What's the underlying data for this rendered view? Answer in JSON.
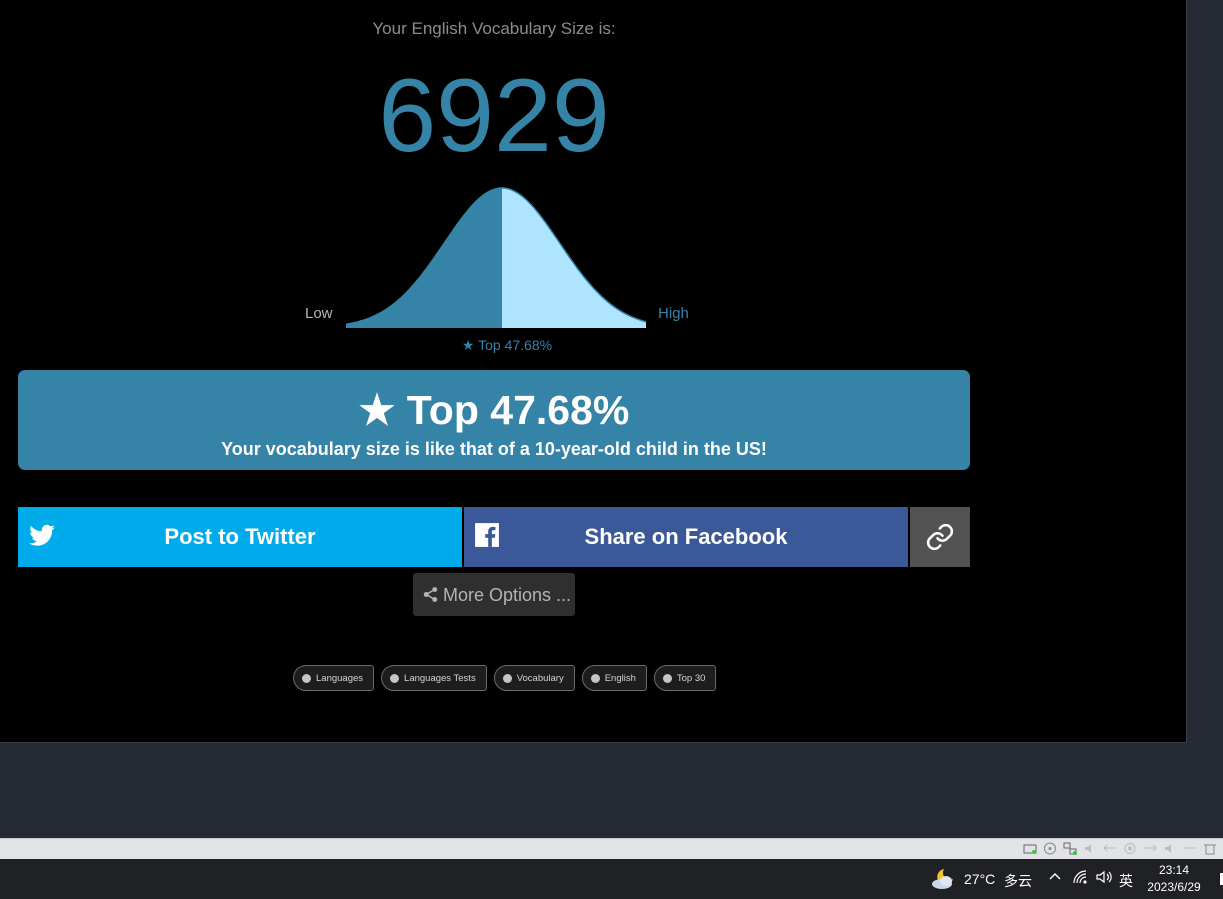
{
  "result": {
    "headline": "Your English Vocabulary Size is:",
    "score": "6929",
    "low_label": "Low",
    "high_label": "High",
    "top_small": "★ Top 47.68%",
    "percentile": 47.68,
    "box_title": "★ Top 47.68%",
    "box_subtitle": "Your vocabulary size is like that of a 10-year-old child in the US!",
    "colors": {
      "accent": "#3584a8",
      "curve_light": "#aee4fd"
    }
  },
  "share": {
    "twitter_label": "Post to Twitter",
    "facebook_label": "Share on Facebook",
    "link_icon": "link-icon",
    "more_label": "More Options ...",
    "colors": {
      "twitter": "#00abec",
      "facebook": "#3b5998",
      "link": "#525252"
    }
  },
  "tags": [
    "Languages",
    "Languages Tests",
    "Vocabulary",
    "English",
    "Top 30"
  ],
  "taskbar": {
    "weather_icon": "partly-cloudy-night-icon",
    "temperature": "27°C",
    "weather": "多云",
    "input_lang": "英",
    "time": "23:14",
    "date": "2023/6/29"
  }
}
